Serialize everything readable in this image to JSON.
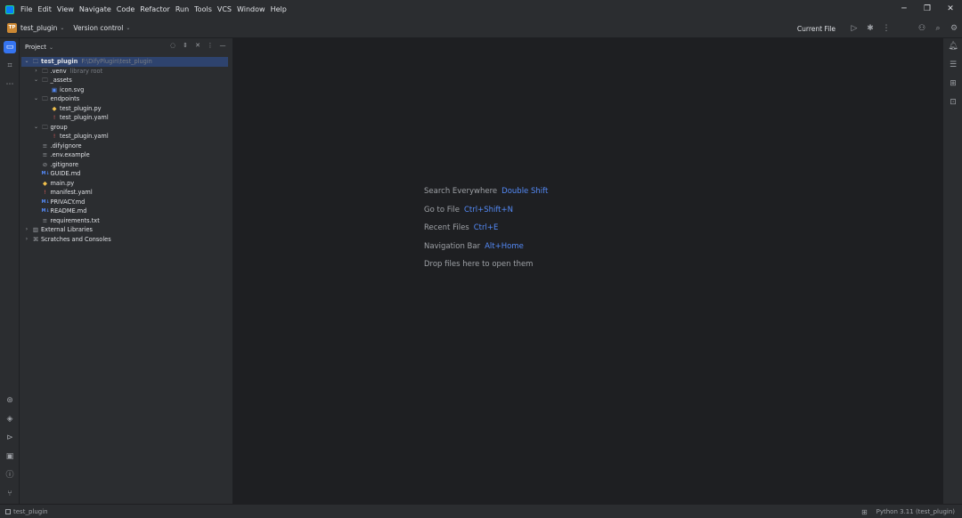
{
  "menu": [
    "File",
    "Edit",
    "View",
    "Navigate",
    "Code",
    "Refactor",
    "Run",
    "Tools",
    "VCS",
    "Window",
    "Help"
  ],
  "toolbar": {
    "project_badge": "TP",
    "project_name": "test_plugin",
    "vcs_label": "Version control",
    "run_config": "Current File"
  },
  "project_panel": {
    "title": "Project",
    "tree": [
      {
        "depth": 0,
        "arrow": "v",
        "icon": "folder",
        "label": "test_plugin",
        "extra": "F:\\DifyPlugin\\test_plugin",
        "selected": true,
        "bold": true
      },
      {
        "depth": 1,
        "arrow": ">",
        "icon": "folder",
        "label": ".venv",
        "extra": "library root"
      },
      {
        "depth": 1,
        "arrow": "v",
        "icon": "folder",
        "label": "_assets"
      },
      {
        "depth": 2,
        "arrow": "",
        "icon": "image",
        "label": "icon.svg"
      },
      {
        "depth": 1,
        "arrow": "v",
        "icon": "folder",
        "label": "endpoints"
      },
      {
        "depth": 2,
        "arrow": "",
        "icon": "python",
        "label": "test_plugin.py"
      },
      {
        "depth": 2,
        "arrow": "",
        "icon": "yaml",
        "label": "test_plugin.yaml"
      },
      {
        "depth": 1,
        "arrow": "v",
        "icon": "folder",
        "label": "group"
      },
      {
        "depth": 2,
        "arrow": "",
        "icon": "yaml",
        "label": "test_plugin.yaml"
      },
      {
        "depth": 1,
        "arrow": "",
        "icon": "text",
        "label": ".difyignore"
      },
      {
        "depth": 1,
        "arrow": "",
        "icon": "text",
        "label": ".env.example"
      },
      {
        "depth": 1,
        "arrow": "",
        "icon": "ignore",
        "label": ".gitignore"
      },
      {
        "depth": 1,
        "arrow": "",
        "icon": "markdown",
        "label": "GUIDE.md"
      },
      {
        "depth": 1,
        "arrow": "",
        "icon": "python",
        "label": "main.py"
      },
      {
        "depth": 1,
        "arrow": "",
        "icon": "yaml",
        "label": "manifest.yaml"
      },
      {
        "depth": 1,
        "arrow": "",
        "icon": "markdown",
        "label": "PRIVACY.md"
      },
      {
        "depth": 1,
        "arrow": "",
        "icon": "markdown",
        "label": "README.md"
      },
      {
        "depth": 1,
        "arrow": "",
        "icon": "text",
        "label": "requirements.txt"
      },
      {
        "depth": 0,
        "arrow": ">",
        "icon": "library",
        "label": "External Libraries"
      },
      {
        "depth": 0,
        "arrow": ">",
        "icon": "scratch",
        "label": "Scratches and Consoles"
      }
    ]
  },
  "editor_hints": [
    {
      "label": "Search Everywhere",
      "key": "Double Shift"
    },
    {
      "label": "Go to File",
      "key": "Ctrl+Shift+N"
    },
    {
      "label": "Recent Files",
      "key": "Ctrl+E"
    },
    {
      "label": "Navigation Bar",
      "key": "Alt+Home"
    },
    {
      "label": "Drop files here to open them",
      "key": ""
    }
  ],
  "statusbar": {
    "project": "test_plugin",
    "interpreter": "Python 3.11 (test_plugin)"
  },
  "colors": {
    "accent": "#3574f0",
    "link": "#548af7",
    "background": "#1e1f22",
    "panel": "#2b2d30",
    "selection": "#2e436e"
  }
}
